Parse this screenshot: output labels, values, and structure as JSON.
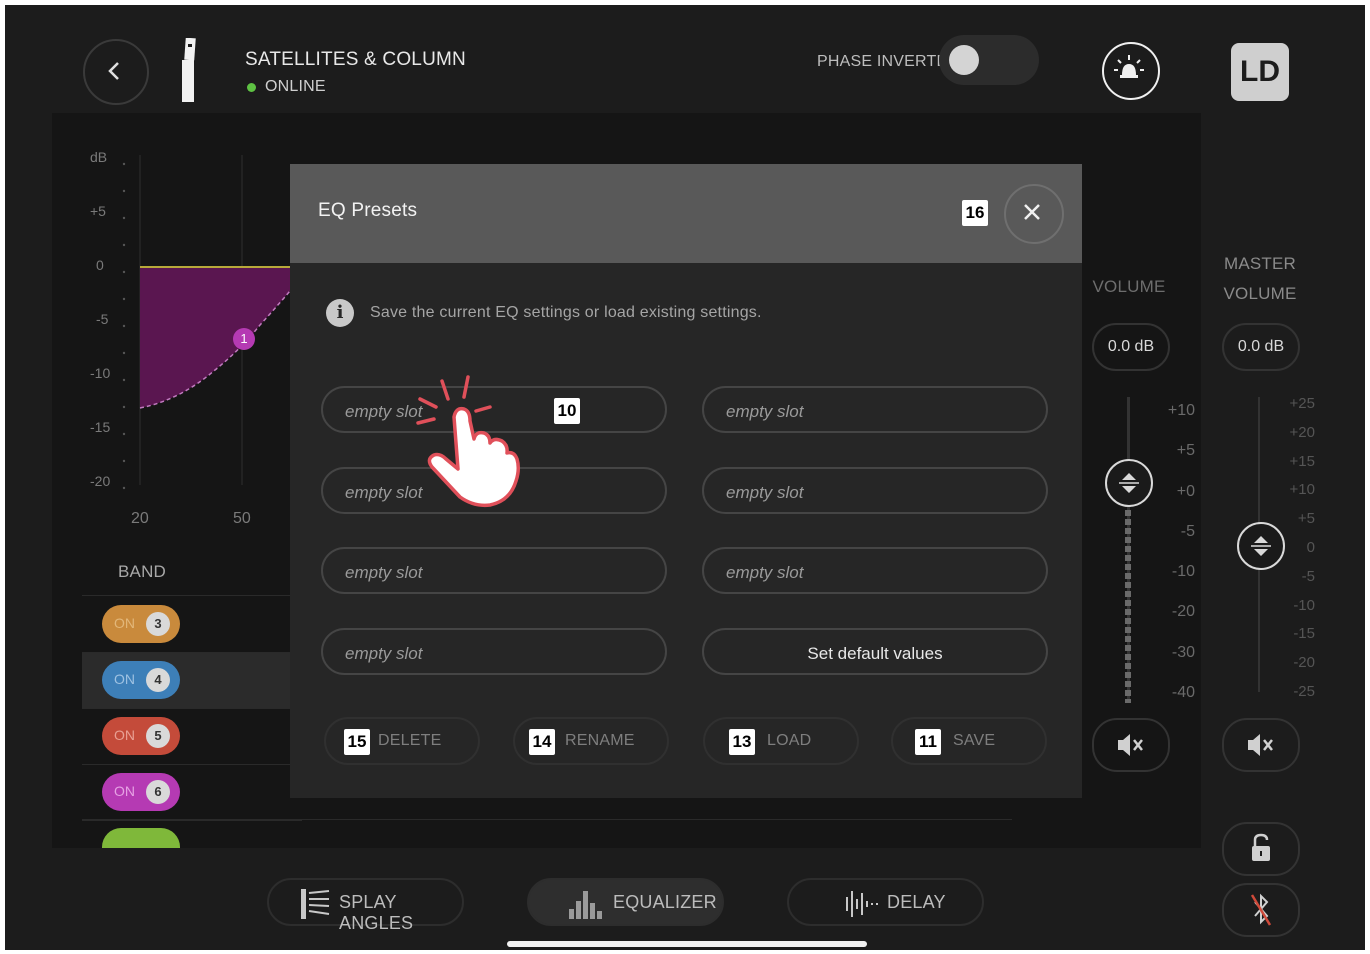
{
  "header": {
    "device_name": "SATELLITES & COLUMN",
    "status": "ONLINE",
    "phase_label": "PHASE INVERTED",
    "phase_inverted": false,
    "logo": "LD"
  },
  "eq_graph": {
    "y_labels": [
      "dB",
      "+5",
      "0",
      "-5",
      "-10",
      "-15",
      "-20"
    ],
    "x_labels": [
      "20",
      "50"
    ],
    "marker": "1"
  },
  "bands": {
    "header": "BAND",
    "rows": [
      {
        "on": "ON",
        "num": "3",
        "color": "#c98a3c"
      },
      {
        "on": "ON",
        "num": "4",
        "color": "#3d7fb8"
      },
      {
        "on": "ON",
        "num": "5",
        "color": "#c44b3a"
      },
      {
        "on": "ON",
        "num": "6",
        "color": "#b53ab3"
      }
    ]
  },
  "volume": {
    "label": "VOLUME",
    "value": "0.0 dB",
    "scale": [
      "+10",
      "+5",
      "+0",
      "-5",
      "-10",
      "-20",
      "-30",
      "-40"
    ]
  },
  "master": {
    "label_line1": "MASTER",
    "label_line2": "VOLUME",
    "value": "0.0 dB",
    "scale": [
      "+25",
      "+20",
      "+15",
      "+10",
      "+5",
      "0",
      "-5",
      "-10",
      "-15",
      "-20",
      "-25"
    ]
  },
  "dialog": {
    "title": "EQ Presets",
    "info": "Save the current EQ settings or load existing settings.",
    "slots_left": [
      "empty slot",
      "empty slot",
      "empty slot",
      "empty slot"
    ],
    "slots_right": [
      "empty slot",
      "empty slot",
      "empty slot"
    ],
    "default_button": "Set default values",
    "actions": {
      "delete": "DELETE",
      "rename": "RENAME",
      "load": "LOAD",
      "save": "SAVE"
    },
    "callouts": {
      "close": "16",
      "slot": "10",
      "delete": "15",
      "rename": "14",
      "load": "13",
      "save": "11"
    }
  },
  "tabs": [
    {
      "label": "SPLAY ANGLES",
      "icon": "splay-icon"
    },
    {
      "label": "EQUALIZER",
      "icon": "equalizer-icon"
    },
    {
      "label": "DELAY",
      "icon": "delay-icon"
    }
  ]
}
